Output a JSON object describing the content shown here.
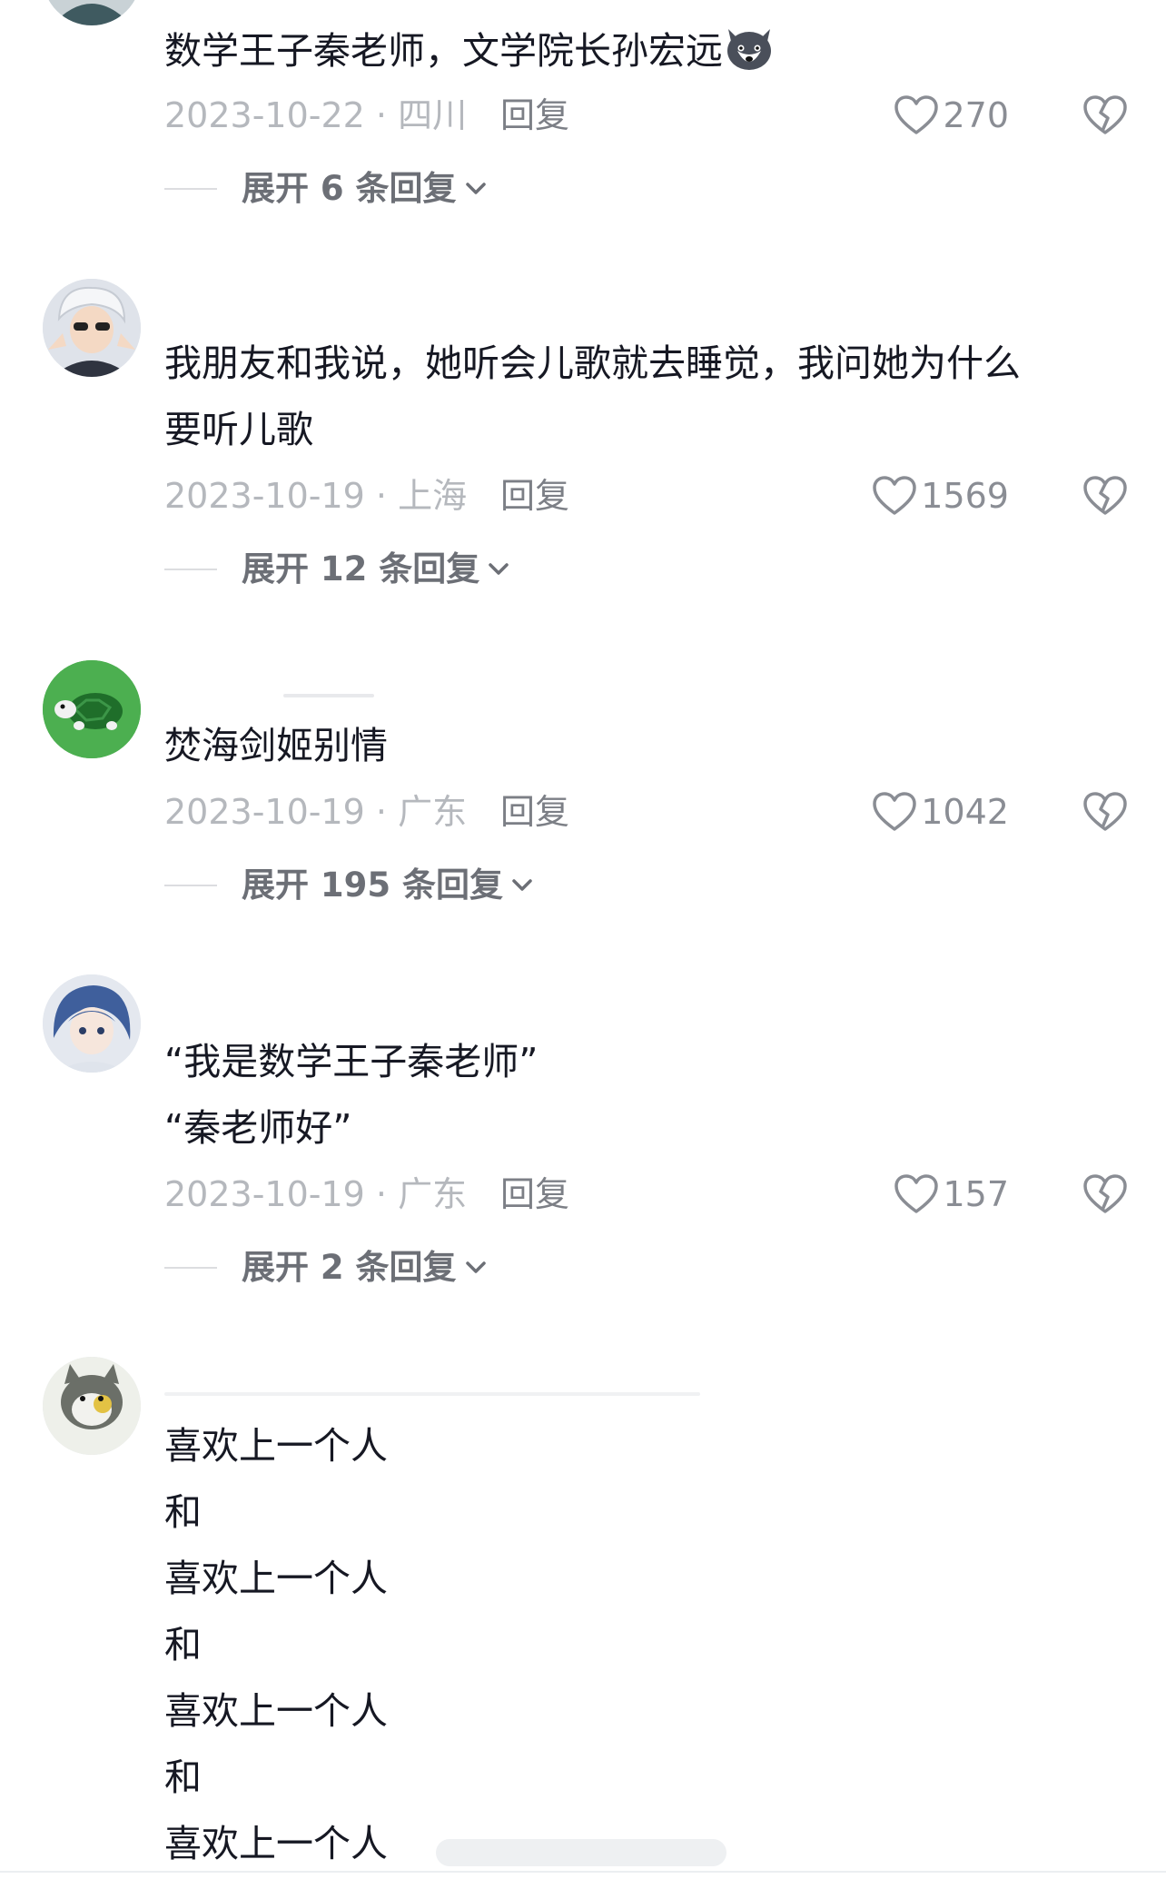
{
  "comments": [
    {
      "lines": [
        "数学王子秦老师，文学院长孙宏远"
      ],
      "emoji": "husky-face-icon",
      "date": "2023-10-22 · 四川",
      "reply_label": "回复",
      "likes": "270",
      "expand_label": "展开 6 条回复"
    },
    {
      "lines": [
        "我朋友和我说，她听会儿歌就去睡觉，我问她为什么",
        "要听儿歌"
      ],
      "date": "2023-10-19 · 上海",
      "reply_label": "回复",
      "likes": "1569",
      "expand_label": "展开 12 条回复"
    },
    {
      "lines": [
        "焚海剑姬别情"
      ],
      "date": "2023-10-19 · 广东",
      "reply_label": "回复",
      "likes": "1042",
      "expand_label": "展开 195 条回复"
    },
    {
      "lines": [
        "“我是数学王子秦老师”",
        "“秦老师好”"
      ],
      "date": "2023-10-19 · 广东",
      "reply_label": "回复",
      "likes": "157",
      "expand_label": "展开 2 条回复"
    },
    {
      "lines": [
        "喜欢上一个人",
        "和",
        "喜欢上一个人",
        "和",
        "喜欢上一个人",
        "和",
        "喜欢上一个人"
      ]
    }
  ],
  "icons": {
    "like": "heart-outline-icon",
    "dislike": "broken-heart-icon",
    "expand": "chevron-down-icon"
  },
  "colors": {
    "text": "#161823",
    "meta": "#b5b8bd",
    "reply": "#7c7f86",
    "expand": "#6c6f76",
    "turtle_avatar_bg": "#4caf50"
  }
}
